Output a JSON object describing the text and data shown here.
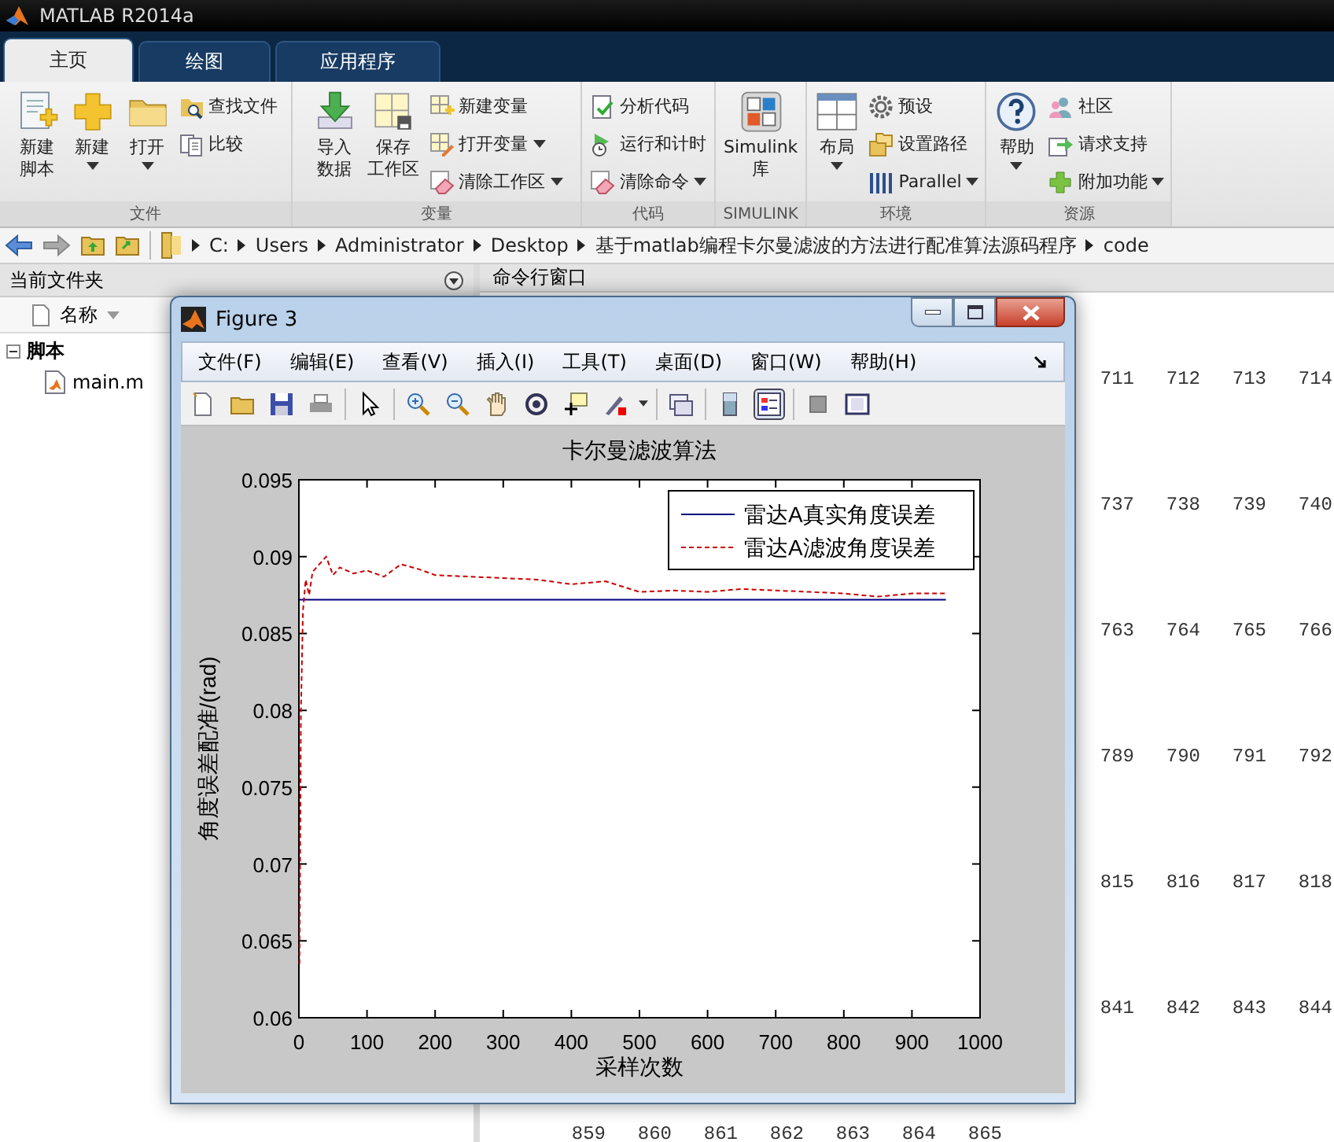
{
  "window": {
    "title": "MATLAB R2014a"
  },
  "ribbon_tabs": [
    {
      "label": "主页",
      "selected": true
    },
    {
      "label": "绘图",
      "selected": false
    },
    {
      "label": "应用程序",
      "selected": false
    }
  ],
  "ribbon_groups": [
    {
      "title": "文件",
      "items": [
        {
          "kind": "large",
          "lines": [
            "新建",
            "脚本"
          ],
          "dropdown": false
        },
        {
          "kind": "large",
          "lines": [
            "新建"
          ],
          "dropdown": true
        },
        {
          "kind": "large",
          "lines": [
            "打开"
          ],
          "dropdown": true
        },
        {
          "kind": "small",
          "lines": [
            "查找文件"
          ],
          "dropdown": false
        },
        {
          "kind": "small",
          "lines": [
            "比较"
          ],
          "dropdown": false
        }
      ]
    },
    {
      "title": "变量",
      "items": [
        {
          "kind": "large",
          "lines": [
            "导入",
            "数据"
          ],
          "dropdown": false
        },
        {
          "kind": "large",
          "lines": [
            "保存",
            "工作区"
          ],
          "dropdown": false
        },
        {
          "kind": "small",
          "lines": [
            "新建变量"
          ],
          "dropdown": false
        },
        {
          "kind": "small",
          "lines": [
            "打开变量"
          ],
          "dropdown": true
        },
        {
          "kind": "small",
          "lines": [
            "清除工作区"
          ],
          "dropdown": true
        }
      ]
    },
    {
      "title": "代码",
      "items": [
        {
          "kind": "small",
          "lines": [
            "分析代码"
          ],
          "dropdown": false
        },
        {
          "kind": "small",
          "lines": [
            "运行和计时"
          ],
          "dropdown": false
        },
        {
          "kind": "small",
          "lines": [
            "清除命令"
          ],
          "dropdown": true
        }
      ]
    },
    {
      "title": "SIMULINK",
      "items": [
        {
          "kind": "large",
          "lines": [
            "Simulink",
            "库"
          ],
          "dropdown": false
        }
      ]
    },
    {
      "title": "环境",
      "items": [
        {
          "kind": "large",
          "lines": [
            "布局"
          ],
          "dropdown": true
        },
        {
          "kind": "small",
          "lines": [
            "预设"
          ],
          "dropdown": false
        },
        {
          "kind": "small",
          "lines": [
            "设置路径"
          ],
          "dropdown": false
        },
        {
          "kind": "small",
          "lines": [
            "Parallel"
          ],
          "dropdown": true
        }
      ]
    },
    {
      "title": "资源",
      "items": [
        {
          "kind": "large",
          "lines": [
            "帮助"
          ],
          "dropdown": true
        },
        {
          "kind": "small",
          "lines": [
            "社区"
          ],
          "dropdown": false
        },
        {
          "kind": "small",
          "lines": [
            "请求支持"
          ],
          "dropdown": false
        },
        {
          "kind": "small",
          "lines": [
            "附加功能"
          ],
          "dropdown": true
        }
      ]
    }
  ],
  "address_bar": {
    "crumbs": [
      "C:",
      "Users",
      "Administrator",
      "Desktop",
      "基于matlab编程卡尔曼滤波的方法进行配准算法源码程序",
      "code"
    ]
  },
  "file_panel": {
    "title": "当前文件夹",
    "column": "名称",
    "tree": [
      {
        "label": "脚本",
        "expanded": true,
        "children": [
          {
            "label": "main.m"
          }
        ]
      }
    ]
  },
  "command_window": {
    "title": "命令行窗口",
    "rows": [
      [
        "711",
        "712",
        "713",
        "714"
      ],
      [
        "737",
        "738",
        "739",
        "740"
      ],
      [
        "763",
        "764",
        "765",
        "766"
      ],
      [
        "789",
        "790",
        "791",
        "792"
      ],
      [
        "815",
        "816",
        "817",
        "818"
      ],
      [
        "841",
        "842",
        "843",
        "844"
      ]
    ],
    "last_row": [
      "859",
      "860",
      "861",
      "862",
      "863",
      "864",
      "865"
    ]
  },
  "figure": {
    "title": "Figure 3",
    "menus": [
      "文件(F)",
      "编辑(E)",
      "查看(V)",
      "插入(I)",
      "工具(T)",
      "桌面(D)",
      "窗口(W)",
      "帮助(H)"
    ],
    "toolbar": [
      {
        "pressed": false
      },
      {
        "pressed": false
      },
      {
        "pressed": false
      },
      {
        "pressed": false
      },
      {
        "pressed": false
      },
      {
        "pressed": false
      },
      {
        "pressed": false
      },
      {
        "pressed": false
      },
      {
        "pressed": false
      },
      {
        "pressed": false
      },
      {
        "pressed": false
      },
      {
        "pressed": false
      },
      {
        "pressed": false
      },
      {
        "pressed": true
      },
      {
        "pressed": false
      },
      {
        "pressed": false
      }
    ],
    "chart_data": {
      "type": "line",
      "title": "卡尔曼滤波算法",
      "xlabel": "采样次数",
      "ylabel": "角度误差配准/(rad)",
      "x": [
        1,
        3,
        6,
        10,
        15,
        20,
        30,
        40,
        50,
        60,
        80,
        100,
        125,
        150,
        175,
        200,
        250,
        300,
        350,
        400,
        450,
        500,
        550,
        600,
        650,
        700,
        750,
        800,
        850,
        900,
        950
      ],
      "series": [
        {
          "name": "雷达A真实角度误差",
          "color": "#000080",
          "line_style": "solid",
          "values": [
            0.0872,
            0.0872,
            0.0872,
            0.0872,
            0.0872,
            0.0872,
            0.0872,
            0.0872,
            0.0872,
            0.0872,
            0.0872,
            0.0872,
            0.0872,
            0.0872,
            0.0872,
            0.0872,
            0.0872,
            0.0872,
            0.0872,
            0.0872,
            0.0872,
            0.0872,
            0.0872,
            0.0872,
            0.0872,
            0.0872,
            0.0872,
            0.0872,
            0.0872,
            0.0872,
            0.0872
          ]
        },
        {
          "name": "雷达A滤波角度误差",
          "color": "#cc0000",
          "line_style": "dashed",
          "values": [
            0.0635,
            0.08,
            0.0865,
            0.0885,
            0.0875,
            0.089,
            0.0895,
            0.09,
            0.0888,
            0.0893,
            0.0889,
            0.0891,
            0.0887,
            0.0895,
            0.0892,
            0.0888,
            0.0887,
            0.0886,
            0.0885,
            0.0882,
            0.0884,
            0.0877,
            0.0878,
            0.0877,
            0.0879,
            0.0878,
            0.0877,
            0.0876,
            0.0874,
            0.0876,
            0.0876
          ]
        }
      ],
      "legend": true,
      "xlim": [
        0,
        1000
      ],
      "ylim": [
        0.06,
        0.095
      ],
      "xticks": [
        0,
        100,
        200,
        300,
        400,
        500,
        600,
        700,
        800,
        900,
        1000
      ],
      "yticks": [
        0.06,
        0.065,
        0.07,
        0.075,
        0.08,
        0.085,
        0.09,
        0.095
      ]
    }
  }
}
